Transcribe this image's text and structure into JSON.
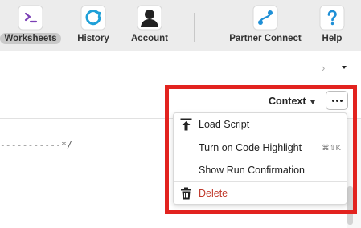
{
  "toolbar": {
    "items": [
      {
        "label": "Worksheets",
        "icon": "worksheets-icon",
        "active": true
      },
      {
        "label": "History",
        "icon": "history-icon"
      },
      {
        "label": "Account",
        "icon": "account-icon"
      },
      {
        "label": "Partner Connect",
        "icon": "partner-connect-icon"
      },
      {
        "label": "Help",
        "icon": "help-icon"
      }
    ]
  },
  "subbar": {
    "chevron": "›"
  },
  "panel": {
    "context_label": "Context"
  },
  "editor": {
    "code_line": "-----------*/"
  },
  "menu": {
    "items": [
      {
        "label": "Load Script",
        "icon": "upload-icon"
      },
      {
        "label": "Turn on Code Highlight",
        "shortcut": "⌘⇧K"
      },
      {
        "label": "Show Run Confirmation"
      },
      {
        "label": "Delete",
        "icon": "trash-icon",
        "danger": true
      }
    ]
  },
  "colors": {
    "highlight": "#e2231f",
    "delete": "#c0392b",
    "worksheets_accent": "#7b3fb5",
    "history_accent": "#1fa0d8",
    "partner_accent": "#1e8fd6"
  }
}
